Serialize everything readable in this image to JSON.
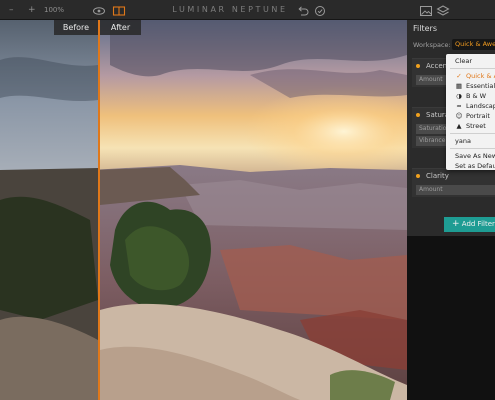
{
  "toolbar": {
    "zoom_out_icon": "minus-icon",
    "zoom_in_icon": "plus-icon",
    "zoom_level": "100%",
    "app_title": "LUMINAR NEPTUNE"
  },
  "canvas": {
    "before_label": "Before",
    "after_label": "After",
    "split_color": "#e0781a"
  },
  "panel": {
    "title": "Filters",
    "workspace_label": "Workspace:",
    "workspace_value": "Quick & Awesome",
    "filters": [
      {
        "name": "Accent",
        "sliders": [
          "Amount"
        ]
      },
      {
        "name": "Saturation",
        "sliders": [
          "Saturation",
          "Vibrance"
        ]
      },
      {
        "name": "Clarity",
        "sliders": [
          "Amount"
        ]
      }
    ],
    "add_filter_label": "Add Filter",
    "accent_color": "#f0a01e",
    "button_color": "#1e9c93"
  },
  "workspace_menu": {
    "top_items": [
      {
        "label": "Clear",
        "icon": "",
        "active": false
      }
    ],
    "preset_items": [
      {
        "label": "Quick & Awesome",
        "icon": "check-icon",
        "active": true
      },
      {
        "label": "Essentials",
        "icon": "grid-icon",
        "active": false
      },
      {
        "label": "B & W",
        "icon": "contrast-icon",
        "active": false
      },
      {
        "label": "Landscape",
        "icon": "mountain-icon",
        "active": false
      },
      {
        "label": "Portrait",
        "icon": "face-icon",
        "active": false
      },
      {
        "label": "Street",
        "icon": "triangle-icon",
        "active": false
      }
    ],
    "user_items": [
      {
        "label": "yana"
      }
    ],
    "action_items": [
      {
        "label": "Save As New"
      },
      {
        "label": "Set as Default"
      }
    ]
  }
}
